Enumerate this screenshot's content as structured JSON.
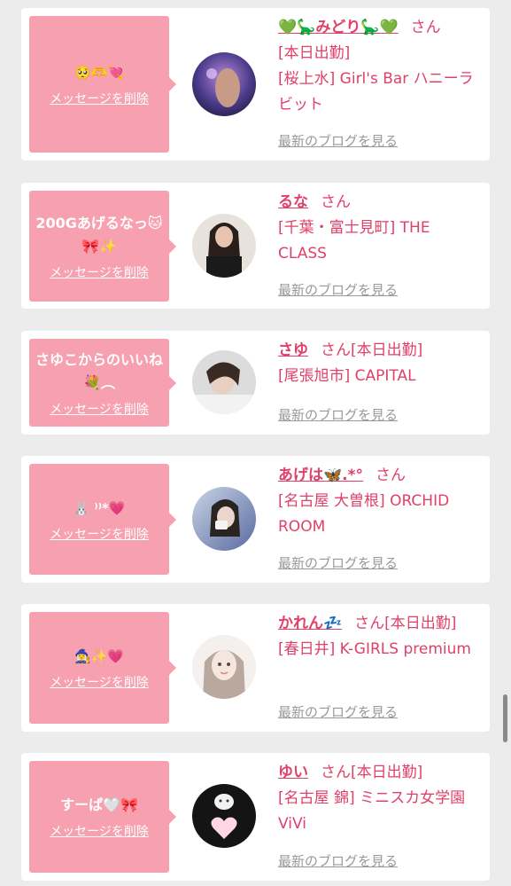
{
  "delete_label": "メッセージを削除",
  "blog_label": "最新のブログを見る",
  "san_label": "さん",
  "cards": [
    {
      "message": "🥺🫶💘",
      "name": "💚🦕みどり🦕💚",
      "status": "[本日出勤]",
      "shop": "[桜上水] Girl's Bar ハニーラビット"
    },
    {
      "message": "200Gあげるなっ🐱🎀✨",
      "name": "るな",
      "status": "",
      "shop": "[千葉・富士見町] THE CLASS"
    },
    {
      "message": "さゆこからのいいね💐︵",
      "name": "さゆ",
      "status": "[本日出勤]",
      "shop": "[尾張旭市] CAPITAL"
    },
    {
      "message": "🐰 ⁾⁾*💗",
      "name": "あげは🦋.*°",
      "status": "",
      "shop": "[名古屋 大曽根] ORCHID ROOM"
    },
    {
      "message": "🧙‍♀️✨💗",
      "name": "かれん💤",
      "status": "[本日出勤]",
      "shop": "[春日井] K-GIRLS premium"
    },
    {
      "message": "すーぱ🤍🎀",
      "name": "ゆい",
      "status": "[本日出勤]",
      "shop": "[名古屋 錦] ミニスカ女学園ViVi"
    }
  ]
}
